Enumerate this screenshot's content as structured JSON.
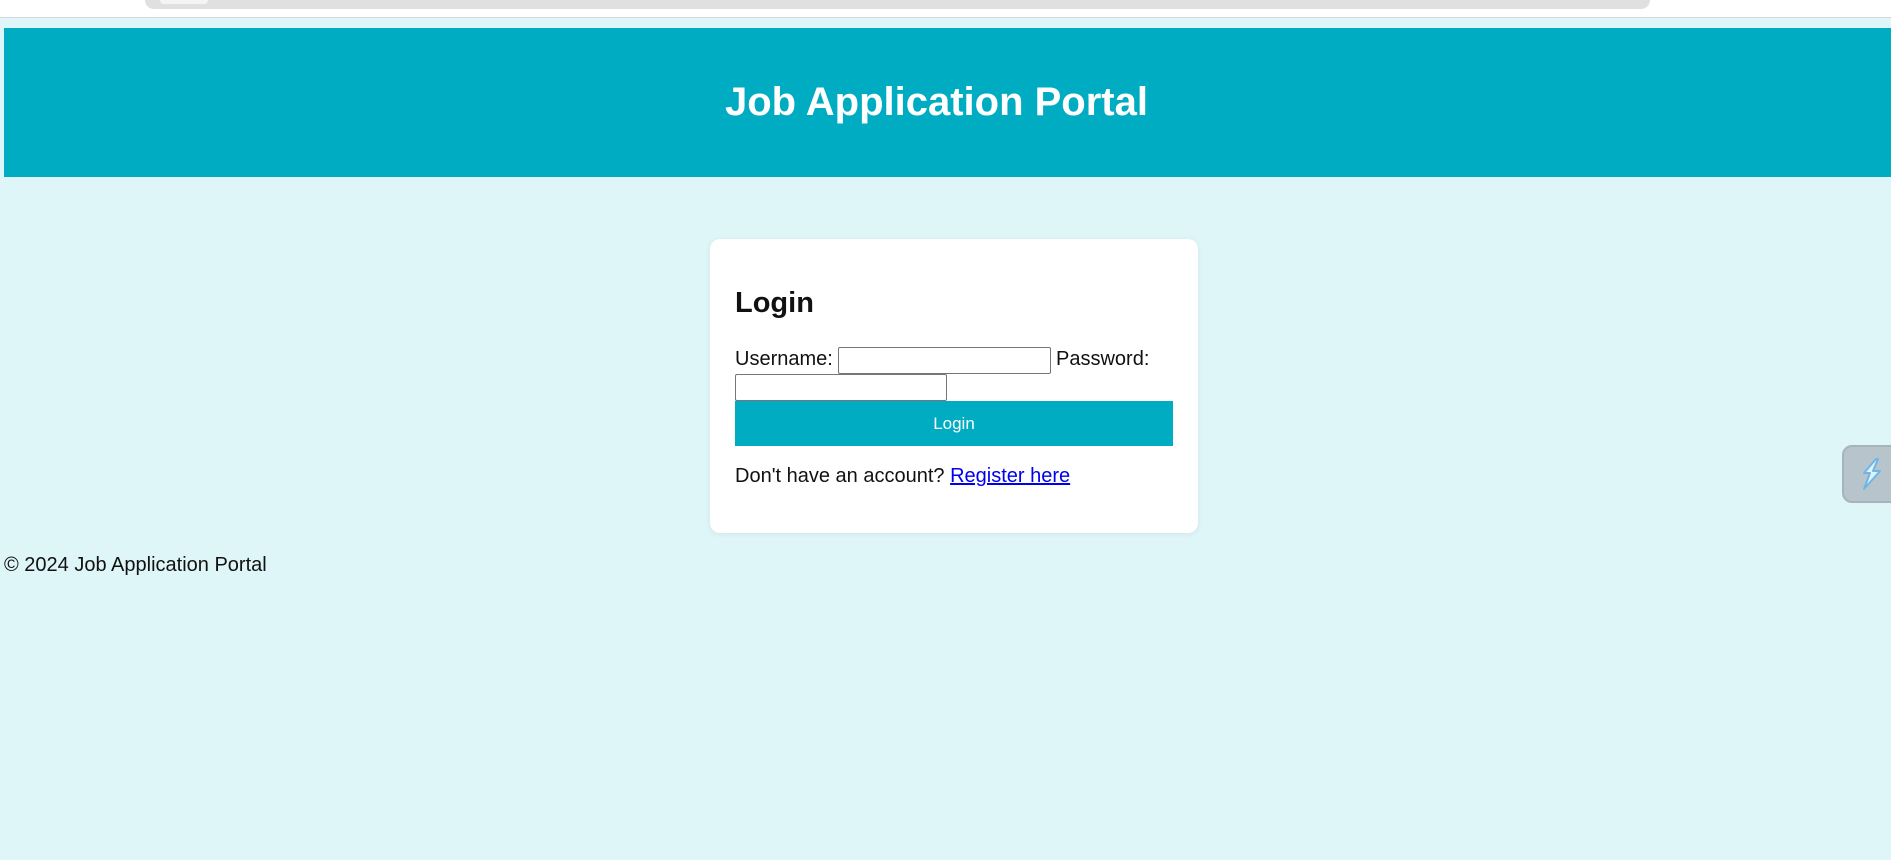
{
  "header": {
    "title": "Job Application Portal"
  },
  "login": {
    "heading": "Login",
    "username_label": "Username:",
    "username_value": "",
    "password_label": "Password:",
    "password_value": "",
    "submit_label": "Login",
    "register_prompt": "Don't have an account?",
    "register_link": "Register here"
  },
  "footer": {
    "text": "© 2024 Job Application Portal"
  },
  "widgets": {
    "side_icon": "lightning-icon"
  },
  "colors": {
    "accent": "#00acc1",
    "page_background": "#dff6f8",
    "card_background": "#ffffff",
    "link": "#0000ee"
  }
}
